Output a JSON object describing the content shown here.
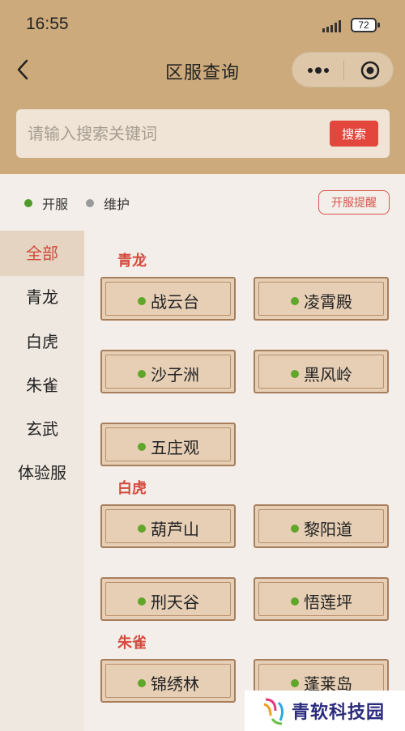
{
  "status_bar": {
    "time": "16:55",
    "battery": "72"
  },
  "nav": {
    "title": "区服查询"
  },
  "search": {
    "placeholder": "请输入搜索关键词",
    "button": "搜索"
  },
  "legend": {
    "open": "开服",
    "maintenance": "维护",
    "open_color": "#4e9a2a",
    "maintenance_color": "#9a9a9a"
  },
  "remind_button": "开服提醒",
  "sidebar": {
    "items": [
      {
        "label": "全部",
        "active": true
      },
      {
        "label": "青龙"
      },
      {
        "label": "白虎"
      },
      {
        "label": "朱雀"
      },
      {
        "label": "玄武"
      },
      {
        "label": "体验服"
      }
    ]
  },
  "groups": [
    {
      "title": "青龙",
      "servers": [
        "战云台",
        "凌霄殿",
        "沙子洲",
        "黑风岭",
        "五庄观"
      ]
    },
    {
      "title": "白虎",
      "servers": [
        "葫芦山",
        "黎阳道",
        "刑天谷",
        "悟莲坪"
      ]
    },
    {
      "title": "朱雀",
      "servers": [
        "锦绣林",
        "蓬莱岛"
      ]
    }
  ],
  "watermark": "青软科技园",
  "colors": {
    "accent_red": "#d24b3e",
    "header_bg": "#cdaa7b",
    "status_open": "#60a62a"
  }
}
